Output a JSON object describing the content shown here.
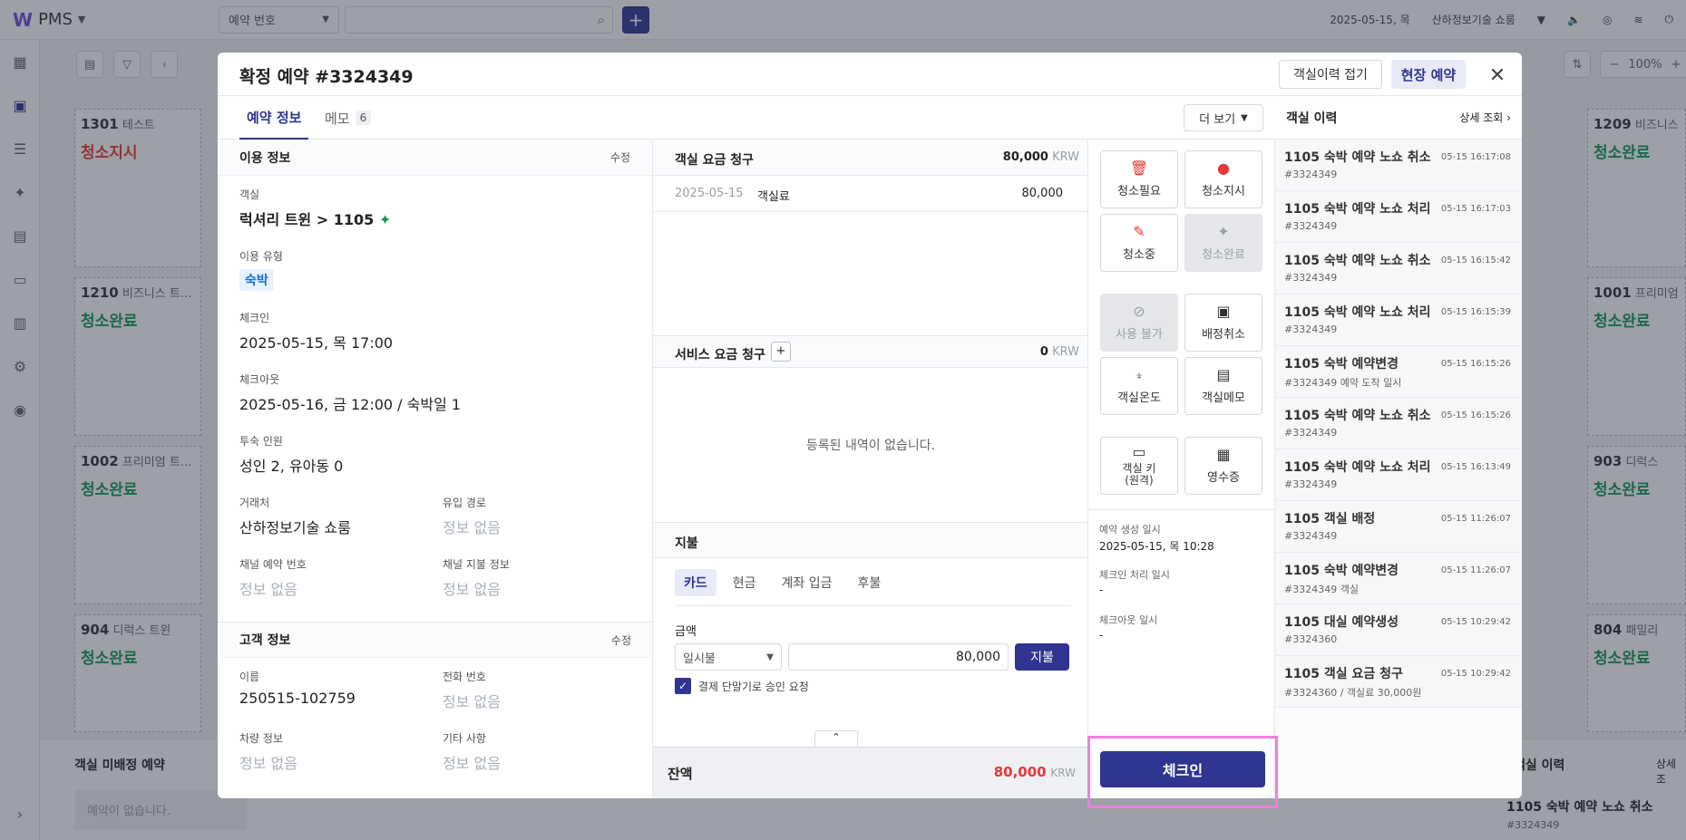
{
  "app": {
    "logo": "W",
    "name": "PMS",
    "search_type": "예약 번호",
    "date": "2025-05-15, 목",
    "property": "산하정보기술 쇼룸"
  },
  "bg": {
    "zoom": "100%",
    "tiles": [
      {
        "room": "1301",
        "type": "테스트",
        "status": "청소지시",
        "status_color": "#e53935"
      },
      {
        "room": "1210",
        "type": "비즈니스 트...",
        "status": "청소완료"
      },
      {
        "room": "1002",
        "type": "프리미엄 트...",
        "status": "청소완료"
      },
      {
        "room": "904",
        "type": "디럭스 트윈",
        "status": "청소완료"
      },
      {
        "room": "1209",
        "type": "비즈니스",
        "status": "청소완료"
      },
      {
        "room": "1001",
        "type": "프리미엄",
        "status": "청소완료"
      },
      {
        "room": "903",
        "type": "디럭스",
        "status": "청소완료"
      },
      {
        "room": "804",
        "type": "패밀리",
        "status": "청소완료"
      }
    ],
    "unassigned_label": "객실 미배정 예약",
    "unassigned_empty": "예약이 없습니다.",
    "right_title": "객실 이력",
    "right_link": "상세 조",
    "right_item": "1105 숙박 예약 노쇼 취소",
    "right_item_sub": "#3324349"
  },
  "modal": {
    "title": "확정 예약 #3324349",
    "btn_history": "객실이력 접기",
    "btn_walkin": "현장 예약",
    "tabs": [
      {
        "label": "예약 정보"
      },
      {
        "label": "메모",
        "count": "6"
      }
    ],
    "more": "더 보기",
    "usage": {
      "title": "이용 정보",
      "edit": "수정",
      "room_label": "객실",
      "room_value": "럭셔리 트윈 > 1105",
      "type_label": "이용 유형",
      "type_value": "숙박",
      "checkin_label": "체크인",
      "checkin_value": "2025-05-15, 목 17:00",
      "checkout_label": "체크아웃",
      "checkout_value": "2025-05-16, 금 12:00 / 숙박일 1",
      "guests_label": "투숙 인원",
      "guests_value": "성인 2, 유아동 0",
      "client_label": "거래처",
      "client_value": "산하정보기술 쇼룸",
      "source_label": "유입 경로",
      "source_value": "정보 없음",
      "channel_no_label": "채널 예약 번호",
      "channel_no_value": "정보 없음",
      "channel_pay_label": "채널 지불 정보",
      "channel_pay_value": "정보 없음"
    },
    "guest": {
      "title": "고객 정보",
      "edit": "수정",
      "name_label": "이름",
      "name_value": "250515-102759",
      "phone_label": "전화 번호",
      "phone_value": "정보 없음",
      "car_label": "차량 정보",
      "car_value": "정보 없음",
      "etc_label": "기타 사항",
      "etc_value": "정보 없음"
    },
    "billing": {
      "title": "객실 요금 청구",
      "total": "80,000",
      "currency": "KRW",
      "rows": [
        {
          "date": "2025-05-15",
          "item": "객실료",
          "amount": "80,000"
        }
      ]
    },
    "service": {
      "title": "서비스 요금 청구",
      "total": "0",
      "currency": "KRW",
      "empty": "등록된 내역이 없습니다."
    },
    "payment": {
      "title": "지불",
      "methods": [
        "카드",
        "현금",
        "계좌 입금",
        "후불"
      ],
      "amount_label": "금액",
      "installment": "일시불",
      "amount": "80,000",
      "pay_btn": "지불",
      "terminal": "결제 단말기로 승인 요청"
    },
    "balance": {
      "label": "잔액",
      "amount": "80,000",
      "currency": "KRW"
    },
    "actions": [
      "청소필요",
      "청소지시",
      "청소중",
      "청소완료",
      "사용 불가",
      "배정취소",
      "객실온도",
      "객실메모",
      "객실 키\n(원격)",
      "영수증"
    ],
    "timeline": {
      "created_label": "예약 생성 일시",
      "created_value": "2025-05-15, 목 10:28",
      "checkin_label": "체크인 처리 일시",
      "checkin_value": "-",
      "checkout_label": "체크아웃 일시",
      "checkout_value": "-"
    },
    "checkin_btn": "체크인",
    "history": {
      "title": "객실 이력",
      "link": "상세 조회",
      "items": [
        {
          "title": "1105 숙박 예약 노쇼 취소",
          "sub": "#3324349",
          "time": "05-15 16:17:08"
        },
        {
          "title": "1105 숙박 예약 노쇼 처리",
          "sub": "#3324349",
          "time": "05-15 16:17:03"
        },
        {
          "title": "1105 숙박 예약 노쇼 취소",
          "sub": "#3324349",
          "time": "05-15 16:15:42"
        },
        {
          "title": "1105 숙박 예약 노쇼 처리",
          "sub": "#3324349",
          "time": "05-15 16:15:39"
        },
        {
          "title": "1105 숙박 예약변경",
          "sub": "#3324349 예약 도착 일시",
          "time": "05-15 16:15:26"
        },
        {
          "title": "1105 숙박 예약 노쇼 취소",
          "sub": "#3324349",
          "time": "05-15 16:15:26"
        },
        {
          "title": "1105 숙박 예약 노쇼 처리",
          "sub": "#3324349",
          "time": "05-15 16:13:49"
        },
        {
          "title": "1105 객실 배정",
          "sub": "#3324349",
          "time": "05-15 11:26:07"
        },
        {
          "title": "1105 숙박 예약변경",
          "sub": "#3324349 객실",
          "time": "05-15 11:26:07"
        },
        {
          "title": "1105 대실 예약생성",
          "sub": "#3324360",
          "time": "05-15 10:29:42"
        },
        {
          "title": "1105 객실 요금 청구",
          "sub": "#3324360 / 객실료 30,000원",
          "time": "05-15 10:29:42"
        }
      ]
    },
    "colors": {
      "primary": "#2f3590",
      "red": "#e53935",
      "green": "#109a56",
      "highlight": "#ee80e0"
    }
  }
}
